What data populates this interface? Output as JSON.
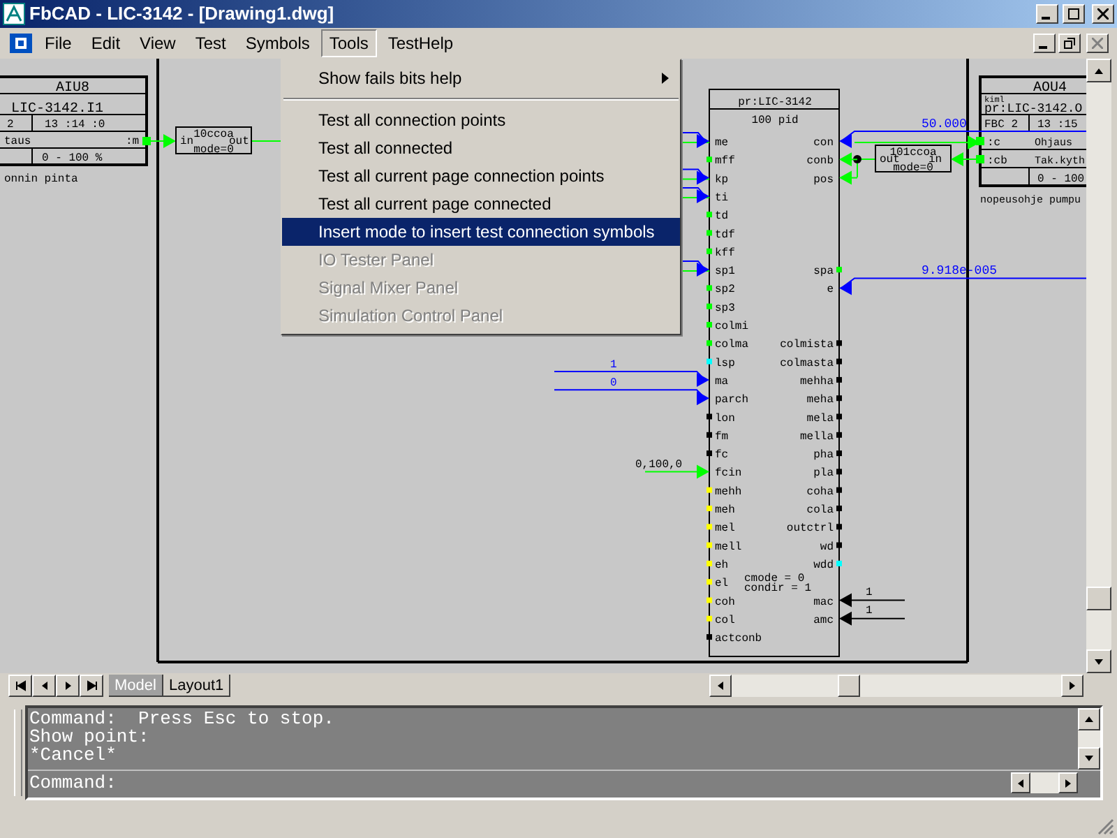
{
  "window": {
    "title": "FbCAD - LIC-3142 - [Drawing1.dwg]"
  },
  "menu": [
    {
      "label": "File",
      "selected": false
    },
    {
      "label": "Edit",
      "selected": false
    },
    {
      "label": "View",
      "selected": false
    },
    {
      "label": "Test",
      "selected": false
    },
    {
      "label": "Symbols",
      "selected": false
    },
    {
      "label": "Tools",
      "selected": true
    },
    {
      "label": "TestHelp",
      "selected": false
    }
  ],
  "tools_menu": [
    {
      "kind": "item",
      "label": "Show fails bits help",
      "selected": false,
      "disabled": false,
      "submenu": true
    },
    {
      "kind": "separator"
    },
    {
      "kind": "item",
      "label": "Test all connection points",
      "selected": false,
      "disabled": false,
      "submenu": false
    },
    {
      "kind": "item",
      "label": "Test all connected",
      "selected": false,
      "disabled": false,
      "submenu": false
    },
    {
      "kind": "item",
      "label": "Test all current page connection points",
      "selected": false,
      "disabled": false,
      "submenu": false
    },
    {
      "kind": "item",
      "label": "Test all current page connected",
      "selected": false,
      "disabled": false,
      "submenu": false
    },
    {
      "kind": "item",
      "label": "Insert mode to insert test connection symbols",
      "selected": true,
      "disabled": false,
      "submenu": false
    },
    {
      "kind": "item",
      "label": "IO Tester Panel",
      "selected": false,
      "disabled": true,
      "submenu": false
    },
    {
      "kind": "item",
      "label": "Signal Mixer Panel",
      "selected": false,
      "disabled": true,
      "submenu": false
    },
    {
      "kind": "item",
      "label": "Simulation Control Panel",
      "selected": false,
      "disabled": true,
      "submenu": false
    }
  ],
  "drawing": {
    "left_block": {
      "title": "AIU8",
      "tag": "LIC-3142.I1",
      "number": "2",
      "time": "13 :14 :0",
      "signal": "taus",
      "port": ":m",
      "range": "0 - 100 %",
      "description": "onnin pinta"
    },
    "left_converter": {
      "name": "10ccoa",
      "input": "in",
      "output": "out",
      "mode": "mode=0"
    },
    "pid_block": {
      "header": "pr:LIC-3142",
      "type": "100 pid",
      "params": [
        "cmode = 0",
        "condir = 1"
      ],
      "left_pins": [
        {
          "label": "me",
          "link": {
            "kind": "bus"
          }
        },
        {
          "label": "mff",
          "color": "#00ff00"
        },
        {
          "label": "kp",
          "link": {
            "kind": "bus"
          }
        },
        {
          "label": "ti",
          "link": {
            "kind": "bus"
          }
        },
        {
          "label": "td",
          "color": "#00ff00"
        },
        {
          "label": "tdf",
          "color": "#00ff00"
        },
        {
          "label": "kff",
          "color": "#00ff00"
        },
        {
          "label": "sp1",
          "link": {
            "kind": "bus"
          }
        },
        {
          "label": "sp2",
          "color": "#00ff00"
        },
        {
          "label": "sp3",
          "color": "#00ff00"
        },
        {
          "label": "colmi",
          "color": "#00ff00"
        },
        {
          "label": "colma",
          "color": "#00ff00"
        },
        {
          "label": "lsp",
          "color": "#00ffff"
        },
        {
          "label": "ma",
          "link": {
            "kind": "value",
            "value": "1"
          }
        },
        {
          "label": "parch",
          "link": {
            "kind": "value",
            "value": "0"
          }
        },
        {
          "label": "lon",
          "color": "#000000"
        },
        {
          "label": "fm",
          "color": "#000000"
        },
        {
          "label": "fc",
          "color": "#000000"
        },
        {
          "label": "fcin",
          "link": {
            "kind": "preset",
            "value": "0,100,0"
          }
        },
        {
          "label": "mehh",
          "color": "#ffff00"
        },
        {
          "label": "meh",
          "color": "#ffff00"
        },
        {
          "label": "mel",
          "color": "#ffff00"
        },
        {
          "label": "mell",
          "color": "#ffff00"
        },
        {
          "label": "eh",
          "color": "#ffff00"
        },
        {
          "label": "el",
          "color": "#ffff00"
        },
        {
          "label": "coh",
          "color": "#ffff00"
        },
        {
          "label": "col",
          "color": "#ffff00"
        },
        {
          "label": "actconb",
          "color": "#000000"
        }
      ],
      "right_pins": [
        {
          "label": "con",
          "link": {
            "kind": "value",
            "value": "50.000"
          }
        },
        {
          "label": "conb",
          "link": {
            "kind": "wire"
          }
        },
        {
          "label": "pos",
          "link": {
            "kind": "wire"
          }
        },
        {
          "label": "spa",
          "color": "#00ff00"
        },
        {
          "label": "e",
          "link": {
            "kind": "value",
            "value": "9.918e-005"
          }
        },
        {
          "label": "colmista",
          "color": "#000000"
        },
        {
          "label": "colmasta",
          "color": "#000000"
        },
        {
          "label": "mehha",
          "color": "#000000"
        },
        {
          "label": "meha",
          "color": "#000000"
        },
        {
          "label": "mela",
          "color": "#000000"
        },
        {
          "label": "mella",
          "color": "#000000"
        },
        {
          "label": "pha",
          "color": "#000000"
        },
        {
          "label": "pla",
          "color": "#000000"
        },
        {
          "label": "coha",
          "color": "#000000"
        },
        {
          "label": "cola",
          "color": "#000000"
        },
        {
          "label": "outctrl",
          "color": "#000000"
        },
        {
          "label": "wd",
          "color": "#000000"
        },
        {
          "label": "wdd",
          "color": "#00ffff"
        },
        {
          "label": "mac",
          "link": {
            "kind": "fixed",
            "value": "1"
          }
        },
        {
          "label": "amc",
          "link": {
            "kind": "fixed",
            "value": "1"
          }
        }
      ]
    },
    "right_converter": {
      "name": "101ccoa",
      "input": "in",
      "output": "out",
      "mode": "mode=0"
    },
    "right_block": {
      "title": "AOU4",
      "label": "kiml",
      "tag": "pr:LIC-3142.O",
      "number": "FBC 2",
      "time": "13 :15",
      "ports": [
        {
          "port": ":c",
          "text": "Ohjaus"
        },
        {
          "port": ":cb",
          "text": "Tak.kyth"
        }
      ],
      "range": "0 - 100",
      "description": "nopeusohje pumpu"
    }
  },
  "layout_tabs": [
    {
      "label": "Model",
      "selected": true
    },
    {
      "label": "Layout1",
      "selected": false
    }
  ],
  "command_history": [
    "Command:  Press Esc to stop.",
    "Show point:",
    "*Cancel*"
  ],
  "command_prompt": "Command:"
}
